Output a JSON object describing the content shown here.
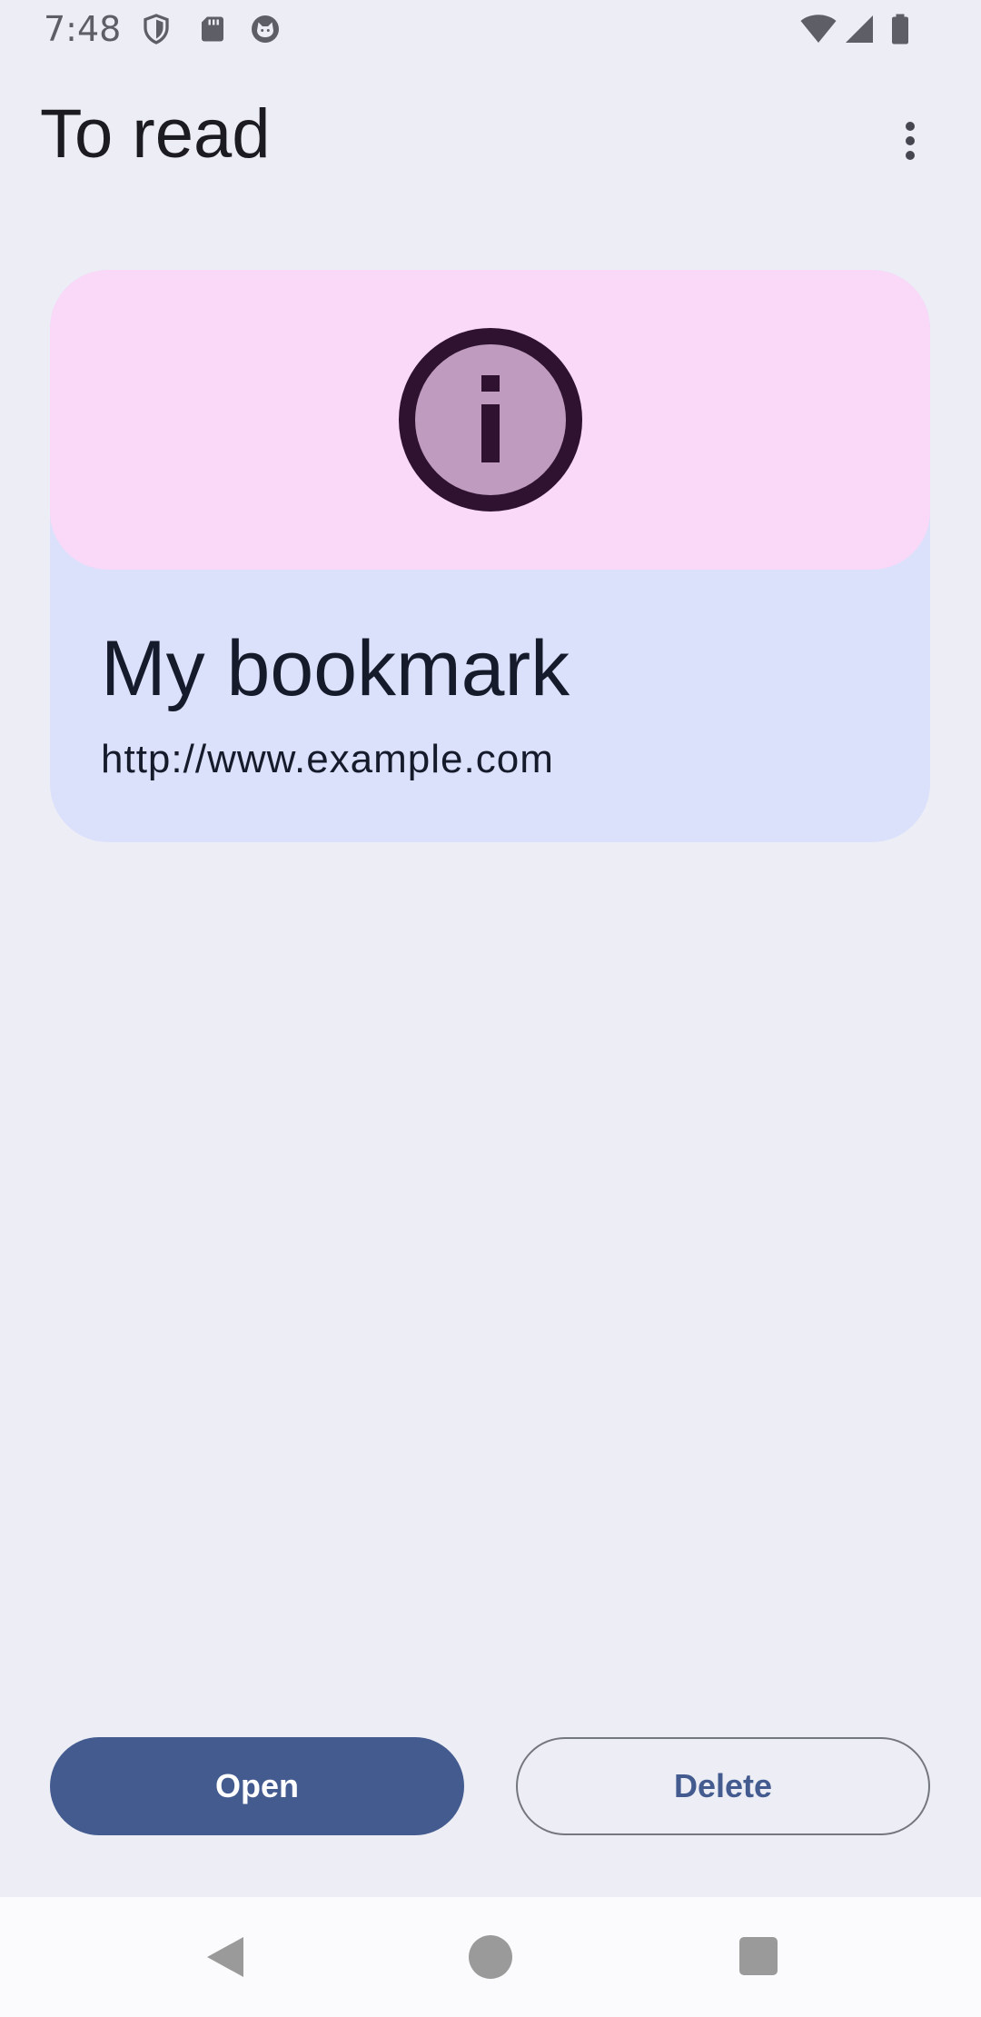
{
  "status_bar": {
    "time": "7:48",
    "left_icons": [
      "shield-icon",
      "sd-card-icon",
      "cat-icon"
    ],
    "right_icons": [
      "wifi-icon",
      "cell-signal-icon",
      "battery-icon"
    ]
  },
  "app_bar": {
    "title": "To read",
    "overflow_icon": "more-vert-icon"
  },
  "card": {
    "icon": "info-icon",
    "title": "My bookmark",
    "url": "http://www.example.com"
  },
  "actions": {
    "open_label": "Open",
    "delete_label": "Delete"
  },
  "nav_bar": {
    "icons": [
      "back-icon",
      "home-icon",
      "recents-icon"
    ]
  },
  "colors": {
    "background": "#edeef5",
    "card_surface": "#dce1fb",
    "card_banner": "#f9d8f8",
    "primary": "#435b8f",
    "info_icon_fill": "#bf9bbf",
    "info_icon_stroke": "#2e1230"
  }
}
